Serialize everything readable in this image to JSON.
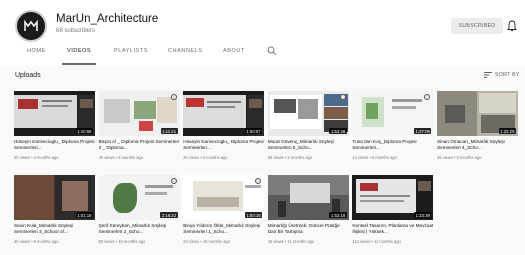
{
  "channel": {
    "name": "MarUn_Architecture",
    "subscribers": "68 subscribers",
    "subscribe_label": "SUBSCRIBED"
  },
  "tabs": [
    "HOME",
    "VIDEOS",
    "PLAYLISTS",
    "CHANNELS",
    "ABOUT"
  ],
  "active_tab": "VIDEOS",
  "section": {
    "title": "Uploads",
    "sort_label": "SORT BY"
  },
  "videos": [
    {
      "title": "Hüseyin Karivecioglu_ Diploma Projesi Seminerleri...",
      "meta": "20 views • 3 months ago",
      "duration": "1:10:56"
    },
    {
      "title": "Büşra Al _ Diploma Projesi Seminerleri 3 _ Diploma...",
      "meta": "30 views • 3 months ago",
      "duration": "1:11:21"
    },
    {
      "title": "Hüseyin Karivecioglu_ Diploma Projesi Seminerleri...",
      "meta": "20 views • 3 months ago",
      "duration": "1:50:07"
    },
    {
      "title": "Murat Güvenç_Mimarlık Söyleşi Seminerleri 5_Scho...",
      "meta": "50 views • 3 months ago",
      "duration": "1:53:49"
    },
    {
      "title": "Tuna Ilan Koç_Diploma Projesi Seminerleri...",
      "meta": "14 views • 8 months ago",
      "duration": "1:27:09"
    },
    {
      "title": "Sinan Omacan_Mimarlık Söyleşi Seminerleri 4_Scho...",
      "meta": "26 views • 9 months ago",
      "duration": "1:22:29"
    },
    {
      "title": "Sevin Kula_Mimarlık Söyleşi Seminerleri 3_School of...",
      "meta": "48 views • 9 months ago",
      "duration": "1:01:18"
    },
    {
      "title": "Şerif Süreyban_Mimarlık Söyleşi Seminerleri 2_Scho...",
      "meta": "50 views • 10 months ago",
      "duration": "2:16:22"
    },
    {
      "title": "Binya Yıldırım Ölde_Mimarlık Söyleşi Seminerleri 1_Scho...",
      "meta": "33 views • 10 months ago",
      "duration": "1:50:18"
    },
    {
      "title": "Mimarlığı Üretmek: Güncel Pratiğe Dair Bir Tartışma",
      "meta": "15 views • 11 months ago",
      "duration": "1:52:18"
    },
    {
      "title": "Kentsel Tasarım, Planlama ve Mevzuat İlişkisi | Yüksek...",
      "meta": "113 views • 11 months ago",
      "duration": "1:33:39"
    }
  ],
  "colors": {
    "accent_underline": "#6a6a6a",
    "header_bg": "#ffffff",
    "page_bg": "#f9f9f9"
  }
}
